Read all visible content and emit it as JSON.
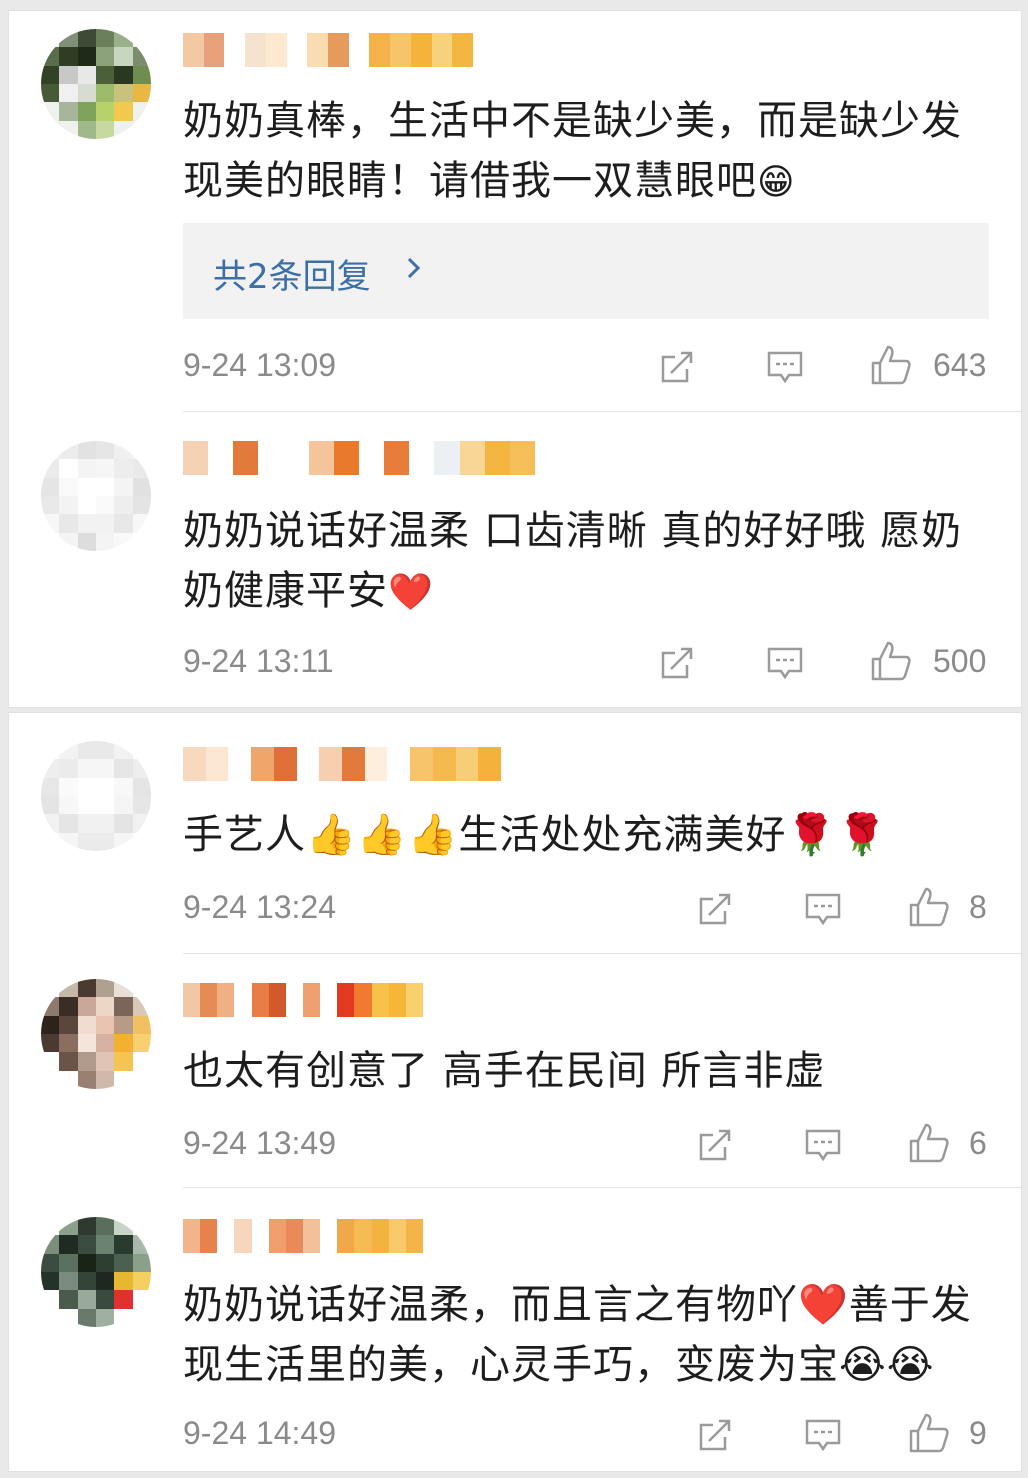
{
  "comments": [
    {
      "text": "奶奶真棒，生活中不是缺少美，而是缺少发现美的眼睛！请借我一双慧眼吧",
      "emoji": "😁",
      "replies_label": "共2条回复",
      "time": "9-24 13:09",
      "likes": "643"
    },
    {
      "text": "奶奶说话好温柔 口齿清晰 真的好好哦 愿奶奶健康平安",
      "emoji": "❤️",
      "time": "9-24 13:11",
      "likes": "500"
    },
    {
      "text": "手艺人👍👍👍生活处处充满美好🌹🌹",
      "time": "9-24 13:24",
      "likes": "8"
    },
    {
      "text": "也太有创意了 高手在民间 所言非虚",
      "time": "9-24 13:49",
      "likes": "6"
    },
    {
      "text": "奶奶说话好温柔，而且言之有物吖❤️善于发现生活里的美，心灵手巧，变废为宝😭😭",
      "time": "9-24 14:49",
      "likes": "9"
    }
  ],
  "colors": {
    "text": "#1d1d1d",
    "meta": "#8a8a8a",
    "link": "#3c6fa8",
    "reply_bg": "#f2f2f2"
  }
}
